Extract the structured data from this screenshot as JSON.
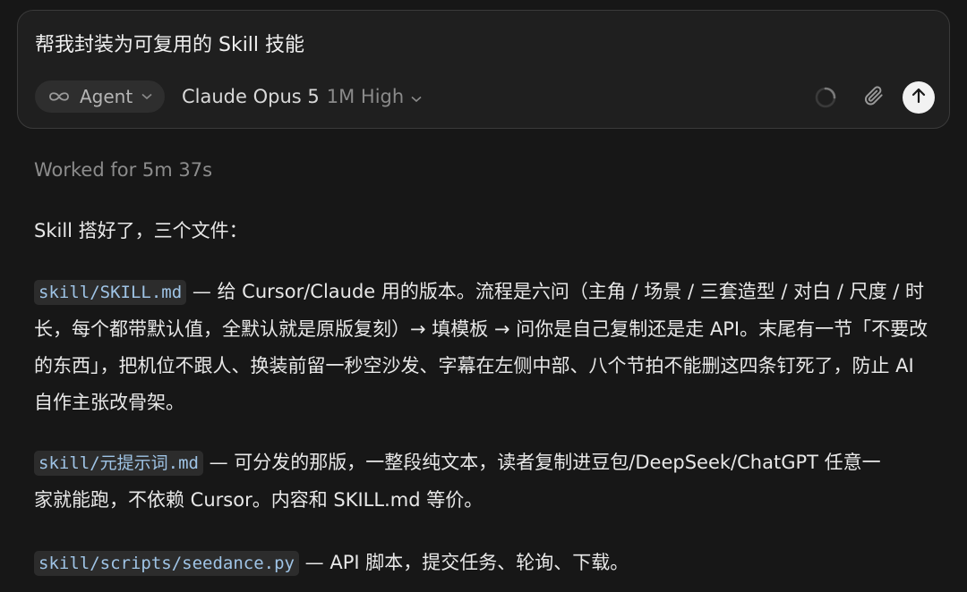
{
  "composer": {
    "prompt_text": "帮我封装为可复用的 Skill 技能",
    "mode": {
      "label": "Agent",
      "icon": "infinity-icon"
    },
    "model": {
      "name": "Claude Opus 5",
      "detail": "1M High",
      "icon": "chevron-down-icon"
    },
    "status_icon": "loading-spinner-icon",
    "attach_icon": "paperclip-icon",
    "send_icon": "arrow-up-icon"
  },
  "response": {
    "worked_for": "Worked for 5m 37s",
    "intro": "Skill 搭好了，三个文件：",
    "files": [
      {
        "path": "skill/SKILL.md",
        "text": " — 给 Cursor/Claude 用的版本。流程是六问（主角 / 场景 / 三套造型 / 对白 / 尺度 / 时长，每个都带默认值，全默认就是原版复刻）→ 填模板 → 问你是自己复制还是走 API。末尾有一节「不要改的东西」，把机位不跟人、换装前留一秒空沙发、字幕在左侧中部、八个节拍不能删这四条钉死了，防止 AI 自作主张改骨架。"
      },
      {
        "path": "skill/元提示词.md",
        "text": " — 可分发的那版，一整段纯文本，读者复制进豆包/DeepSeek/ChatGPT 任意一家就能跑，不依赖 Cursor。内容和 SKILL.md 等价。"
      },
      {
        "path": "skill/scripts/seedance.py",
        "text": " — API 脚本，提交任务、轮询、下载。"
      }
    ]
  },
  "colors": {
    "background": "#171717",
    "composer_bg": "#1f1f1f",
    "code_bg": "#2c2c2c",
    "code_text": "#9fc4e6",
    "muted_text": "#8c8c8c"
  }
}
